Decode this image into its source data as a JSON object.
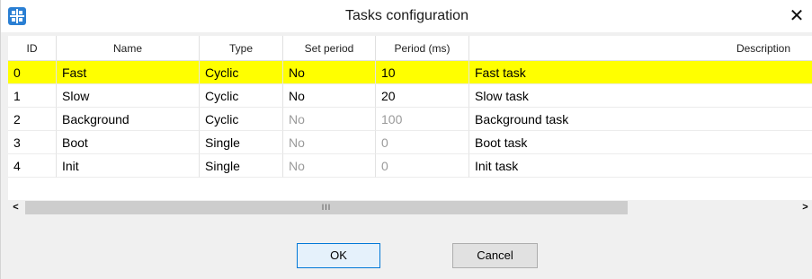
{
  "window": {
    "title": "Tasks configuration",
    "close_glyph": "✕",
    "icon": "app-task-icon"
  },
  "table": {
    "columns": [
      "ID",
      "Name",
      "Type",
      "Set period",
      "Period (ms)",
      "Description"
    ],
    "rows": [
      {
        "id": "0",
        "name": "Fast",
        "type": "Cyclic",
        "set_period": "No",
        "period": "10",
        "description": "Fast task",
        "selected": true
      },
      {
        "id": "1",
        "name": "Slow",
        "type": "Cyclic",
        "set_period": "No",
        "period": "20",
        "description": "Slow task",
        "selected": false
      },
      {
        "id": "2",
        "name": "Background",
        "type": "Cyclic",
        "set_period": "No",
        "period": "100",
        "description": "Background task",
        "selected": false
      },
      {
        "id": "3",
        "name": "Boot",
        "type": "Single",
        "set_period": "No",
        "period": "0",
        "description": "Boot task",
        "selected": false
      },
      {
        "id": "4",
        "name": "Init",
        "type": "Single",
        "set_period": "No",
        "period": "0",
        "description": "Init task",
        "selected": false
      }
    ],
    "selected_color": "#ffff00"
  },
  "scrollbar": {
    "left_glyph": "<",
    "right_glyph": ">",
    "grip": "III"
  },
  "buttons": {
    "ok": "OK",
    "cancel": "Cancel"
  }
}
